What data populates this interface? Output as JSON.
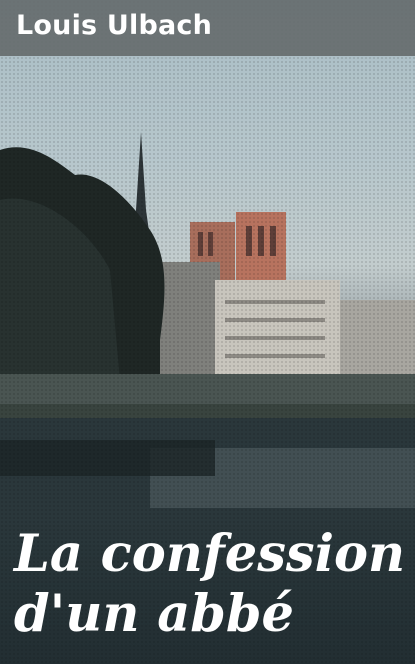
{
  "cover": {
    "author": "Louis Ulbach",
    "title_line1": "La confession",
    "title_line2": "d'un abbé"
  },
  "colors": {
    "author_bar": "#666c6e",
    "text": "#ffffff",
    "sky": "#b7c7cc",
    "tower": "#b7735f",
    "water": "#1d292d"
  }
}
